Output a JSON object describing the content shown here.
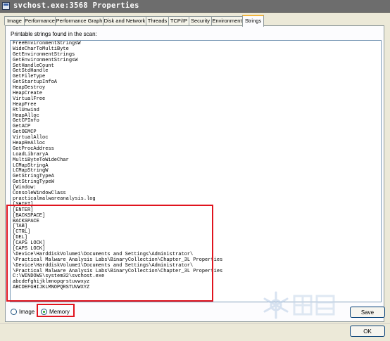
{
  "window": {
    "title": "svchost.exe:3568 Properties"
  },
  "tabs": [
    {
      "label": "Image"
    },
    {
      "label": "Performance"
    },
    {
      "label": "Performance Graph"
    },
    {
      "label": "Disk and Network"
    },
    {
      "label": "Threads"
    },
    {
      "label": "TCP/IP"
    },
    {
      "label": "Security"
    },
    {
      "label": "Environment"
    },
    {
      "label": "Strings"
    }
  ],
  "active_tab": "Strings",
  "caption": "Printable strings found in the scan:",
  "strings": [
    "FreeEnvironmentStringsW",
    "WideCharToMultiByte",
    "GetEnvironmentStrings",
    "GetEnvironmentStringsW",
    "SetHandleCount",
    "GetStdHandle",
    "GetFileType",
    "GetStartupInfoA",
    "HeapDestroy",
    "HeapCreate",
    "VirtualFree",
    "HeapFree",
    "RtlUnwind",
    "HeapAlloc",
    "GetCPInfo",
    "GetACP",
    "GetOEMCP",
    "VirtualAlloc",
    "HeapReAlloc",
    "GetProcAddress",
    "LoadLibraryA",
    "MultiByteToWideChar",
    "LCMapStringA",
    "LCMapStringW",
    "GetStringTypeA",
    "GetStringTypeW",
    "[Window:",
    "ConsoleWindowClass",
    "practicalmalwareanalysis.log",
    "[SHIFT]",
    "[ENTER]",
    "[BACKSPACE]",
    "BACKSPACE",
    "[TAB]",
    "[CTRL]",
    "[DEL]",
    "[CAPS LOCK]",
    "[CAPS LOCK]",
    "\\Device\\HarddiskVolume1\\Documents and Settings\\Administrator\\",
    "\\Practical Malware Analysis Labs\\BinaryCollection\\Chapter_3L Properties",
    "\\Device\\HarddiskVolume1\\Documents and Settings\\Administrator\\",
    "\\Practical Malware Analysis Labs\\BinaryCollection\\Chapter_3L Properties",
    "C:\\WINDOWS\\system32\\svchost.exe",
    "abcdefghijklmnopqrstuvwxyz",
    "ABCDEFGHIJKLMNOPQRSTUVWXYZ"
  ],
  "scan_options": {
    "image_label": "Image",
    "memory_label": "Memory",
    "selected": "Memory"
  },
  "buttons": {
    "save": "Save",
    "ok": "OK"
  },
  "colors": {
    "highlight": "#e0141e",
    "title_bar": "#6d6d6d",
    "tab_accent": "#f2b53e"
  }
}
